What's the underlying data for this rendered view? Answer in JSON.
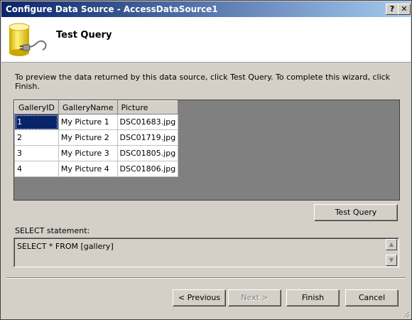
{
  "window": {
    "title": "Configure Data Source - AccessDataSource1",
    "help_label": "?",
    "close_label": "✕"
  },
  "header": {
    "title": "Test Query"
  },
  "instructions": "To preview the data returned by this data source, click Test Query. To complete this wizard, click Finish.",
  "grid": {
    "columns": [
      "GalleryID",
      "GalleryName",
      "Picture"
    ],
    "rows": [
      [
        "1",
        "My Picture 1",
        "DSC01683.jpg"
      ],
      [
        "2",
        "My Picture 2",
        "DSC01719.jpg"
      ],
      [
        "3",
        "My Picture 3",
        "DSC01805.jpg"
      ],
      [
        "4",
        "My Picture 4",
        "DSC01806.jpg"
      ]
    ]
  },
  "test_query_label": "Test Query",
  "select_statement": {
    "label": "SELECT statement:",
    "value": "SELECT * FROM [gallery]"
  },
  "footer": {
    "previous_label": "< Previous",
    "next_label": "Next >",
    "finish_label": "Finish",
    "cancel_label": "Cancel"
  },
  "colors": {
    "titlebar_start": "#0a246a",
    "titlebar_end": "#a6caf0",
    "selection": "#0a246a",
    "dialog_bg": "#d4d0c8"
  }
}
